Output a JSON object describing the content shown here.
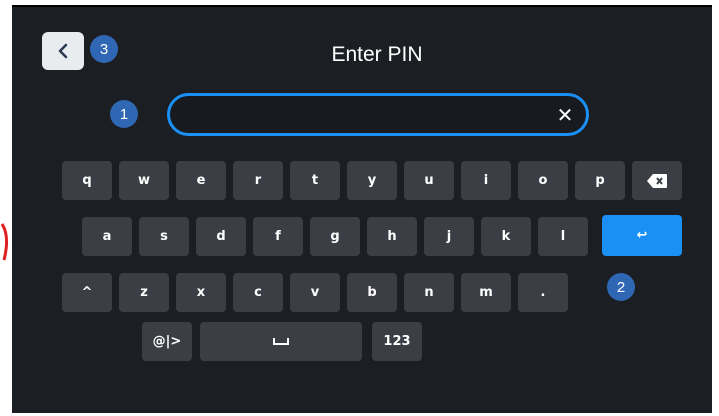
{
  "header": {
    "title": "Enter PIN",
    "back_icon": "chevron-left-icon"
  },
  "pin_field": {
    "value": "",
    "clear_icon": "close-icon",
    "clear_glyph": "✕"
  },
  "badges": {
    "back": "3",
    "input": "1",
    "enter": "2"
  },
  "keyboard": {
    "row1": [
      "q",
      "w",
      "e",
      "r",
      "t",
      "y",
      "u",
      "i",
      "o",
      "p"
    ],
    "backspace_icon": "backspace-icon",
    "row2": [
      "a",
      "s",
      "d",
      "f",
      "g",
      "h",
      "j",
      "k",
      "l"
    ],
    "enter_icon": "enter-icon",
    "enter_glyph": "↩",
    "row3_shift": "^",
    "row3": [
      "z",
      "x",
      "c",
      "v",
      "b",
      "n",
      "m",
      "."
    ],
    "email_key": "@|>",
    "space_glyph": "␣",
    "numbers_key": "123"
  },
  "colors": {
    "background": "#1b1e23",
    "key": "#3b3f45",
    "accent": "#1a8ff4",
    "badge": "#2f67b4"
  }
}
